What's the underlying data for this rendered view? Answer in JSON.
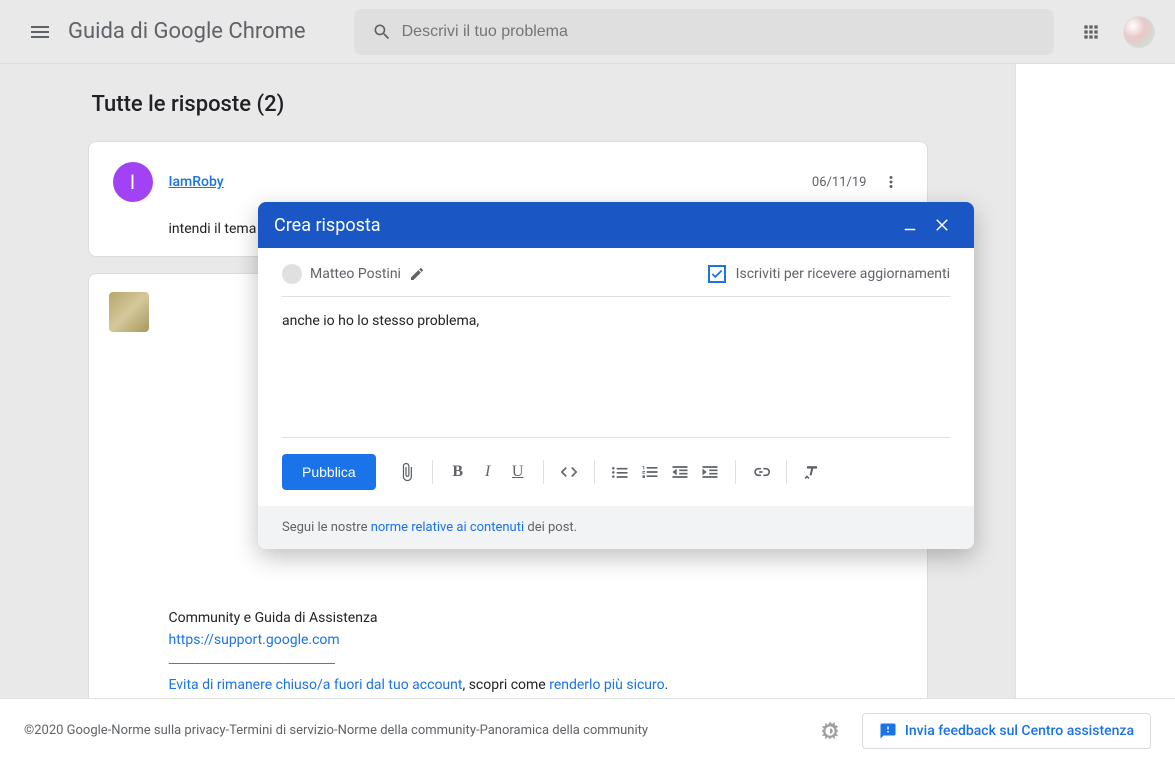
{
  "header": {
    "title": "Guida di Google Chrome",
    "search_placeholder": "Descrivi il tuo problema"
  },
  "thread": {
    "all_replies_label": "Tutte le risposte (2)",
    "reply1": {
      "user": "IamRoby",
      "initial": "I",
      "date": "06/11/19",
      "body": "intendi il tema scuro? vedi nel sistema o su Chrome per mettere quello chiaro, io uso Windows,"
    },
    "reply2": {
      "sig_line1": "Community e Guida di Assistenza",
      "link1": "https://support.google.com",
      "lockout_prefix_link": "Evita di rimanere chiuso/a fuori dal tuo account",
      "lockout_mid": ", scopri come ",
      "lockout_link2": "renderlo più sicuro",
      "period": "."
    }
  },
  "dialog": {
    "title": "Crea risposta",
    "user": "Matteo Postini",
    "subscribe_label": "Iscriviti per ricevere aggiornamenti",
    "subscribe_checked": true,
    "editor_text": "anche io ho lo stesso problema,",
    "publish": "Pubblica",
    "footer_prefix": "Segui le nostre ",
    "footer_link": "norme relative ai contenuti",
    "footer_suffix": " dei post."
  },
  "footer": {
    "copyright": "©2020 Google",
    "sep": " - ",
    "privacy": "Norme sulla privacy",
    "terms": "Termini di servizio",
    "community_norms": "Norme della community",
    "community_overview": "Panoramica della community",
    "feedback": "Invia feedback sul Centro assistenza"
  }
}
